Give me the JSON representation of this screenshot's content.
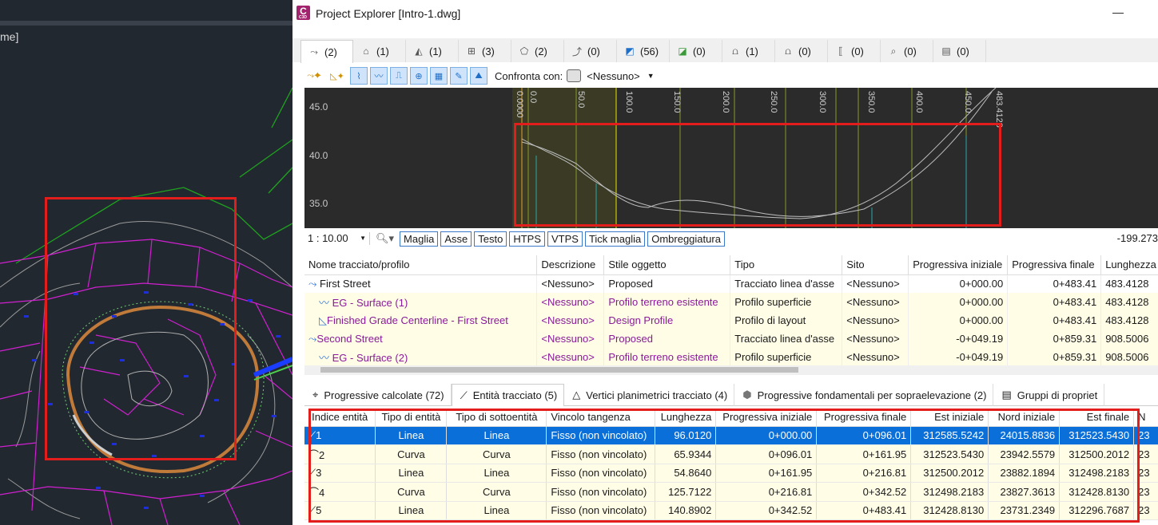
{
  "cad": {
    "menu_fragment": "me]"
  },
  "window": {
    "title": "Project Explorer [Intro-1.dwg]",
    "app_logo": "C",
    "minimize_glyph": "—"
  },
  "object_tabs": [
    {
      "icon": "alignment-icon",
      "count": "(2)"
    },
    {
      "icon": "corridor-icon",
      "count": "(1)"
    },
    {
      "icon": "road-icon",
      "count": "(1)"
    },
    {
      "icon": "grading-icon",
      "count": "(3)"
    },
    {
      "icon": "surface-icon",
      "count": "(2)"
    },
    {
      "icon": "feature-line-icon",
      "count": "(0)"
    },
    {
      "icon": "parcel-icon",
      "count": "(56)"
    },
    {
      "icon": "point-group-icon",
      "count": "(0)"
    },
    {
      "icon": "pipe-icon",
      "count": "(1)"
    },
    {
      "icon": "pressure-pipe-icon",
      "count": "(0)"
    },
    {
      "icon": "structure-icon",
      "count": "(0)"
    },
    {
      "icon": "survey-icon",
      "count": "(0)"
    },
    {
      "icon": "sheet-icon",
      "count": "(0)"
    }
  ],
  "toolbar": {
    "compare_label": "Confronta con:",
    "compare_value": "<Nessuno>"
  },
  "profile_view": {
    "y_labels": [
      "45.0",
      "40.0",
      "35.0"
    ],
    "station_labels": [
      "0.0000",
      "0.0",
      "50.0",
      "100.0",
      "150.0",
      "200.0",
      "250.0",
      "300.0",
      "350.0",
      "400.0",
      "450.0",
      "483.4128"
    ]
  },
  "profile_tools": {
    "scale": "1 : 10.00",
    "buttons": [
      "Maglia",
      "Asse",
      "Testo",
      "HTPS",
      "VTPS",
      "Tick maglia",
      "Ombreggiatura"
    ],
    "coordinate": "-199.273"
  },
  "alignments_grid": {
    "headers": [
      "Nome tracciato/profilo",
      "Descrizione",
      "Stile oggetto",
      "Tipo",
      "Sito",
      "Progressiva iniziale",
      "Progressiva finale",
      "Lunghezza"
    ],
    "rows": [
      [
        "First Street",
        "<Nessuno>",
        "Proposed",
        "Tracciato linea d'asse",
        "<Nessuno>",
        "0+000.00",
        "0+483.41",
        "483.4128"
      ],
      [
        "EG - Surface (1)",
        "<Nessuno>",
        "Profilo terreno esistente",
        "Profilo superficie",
        "<Nessuno>",
        "0+000.00",
        "0+483.41",
        "483.4128"
      ],
      [
        "Finished Grade Centerline - First Street",
        "<Nessuno>",
        "Design Profile",
        "Profilo di layout",
        "<Nessuno>",
        "0+000.00",
        "0+483.41",
        "483.4128"
      ],
      [
        "Second Street",
        "<Nessuno>",
        "Proposed",
        "Tracciato linea d'asse",
        "<Nessuno>",
        "-0+049.19",
        "0+859.31",
        "908.5006"
      ],
      [
        "EG - Surface (2)",
        "<Nessuno>",
        "Profilo terreno esistente",
        "Profilo superficie",
        "<Nessuno>",
        "-0+049.19",
        "0+859.31",
        "908.5006"
      ]
    ]
  },
  "bottom_tabs": [
    {
      "icon": "crosshair-icon",
      "label": "Progressive calcolate (72)"
    },
    {
      "icon": "line-entity-icon",
      "label": "Entità tracciato (5)"
    },
    {
      "icon": "triangle-icon",
      "label": "Vertici planimetrici tracciato (4)"
    },
    {
      "icon": "superelevation-icon",
      "label": "Progressive fondamentali per sopraelevazione (2)"
    },
    {
      "icon": "property-sets-icon",
      "label": "Gruppi di propriet"
    }
  ],
  "entities_grid": {
    "headers": [
      "Indice entità",
      "Tipo di entità",
      "Tipo di sottoentità",
      "Vincolo tangenza",
      "Lunghezza",
      "Progressiva iniziale",
      "Progressiva finale",
      "Est iniziale",
      "Nord iniziale",
      "Est finale",
      "N"
    ],
    "rows": [
      [
        "1",
        "Linea",
        "Linea",
        "Fisso (non vincolato)",
        "96.0120",
        "0+000.00",
        "0+096.01",
        "312585.5242",
        "24015.8836",
        "312523.5430",
        "23"
      ],
      [
        "2",
        "Curva",
        "Curva",
        "Fisso (non vincolato)",
        "65.9344",
        "0+096.01",
        "0+161.95",
        "312523.5430",
        "23942.5579",
        "312500.2012",
        "23"
      ],
      [
        "3",
        "Linea",
        "Linea",
        "Fisso (non vincolato)",
        "54.8640",
        "0+161.95",
        "0+216.81",
        "312500.2012",
        "23882.1894",
        "312498.2183",
        "23"
      ],
      [
        "4",
        "Curva",
        "Curva",
        "Fisso (non vincolato)",
        "125.7122",
        "0+216.81",
        "0+342.52",
        "312498.2183",
        "23827.3613",
        "312428.8130",
        "23"
      ],
      [
        "5",
        "Linea",
        "Linea",
        "Fisso (non vincolato)",
        "140.8902",
        "0+342.52",
        "0+483.41",
        "312428.8130",
        "23731.2349",
        "312296.7687",
        "23"
      ]
    ]
  },
  "colors": {
    "selection": "#0a6fd8",
    "highlight_box": "#e31c1c",
    "row_yellow": "#fffde6",
    "purple_text": "#8b1a9b"
  }
}
